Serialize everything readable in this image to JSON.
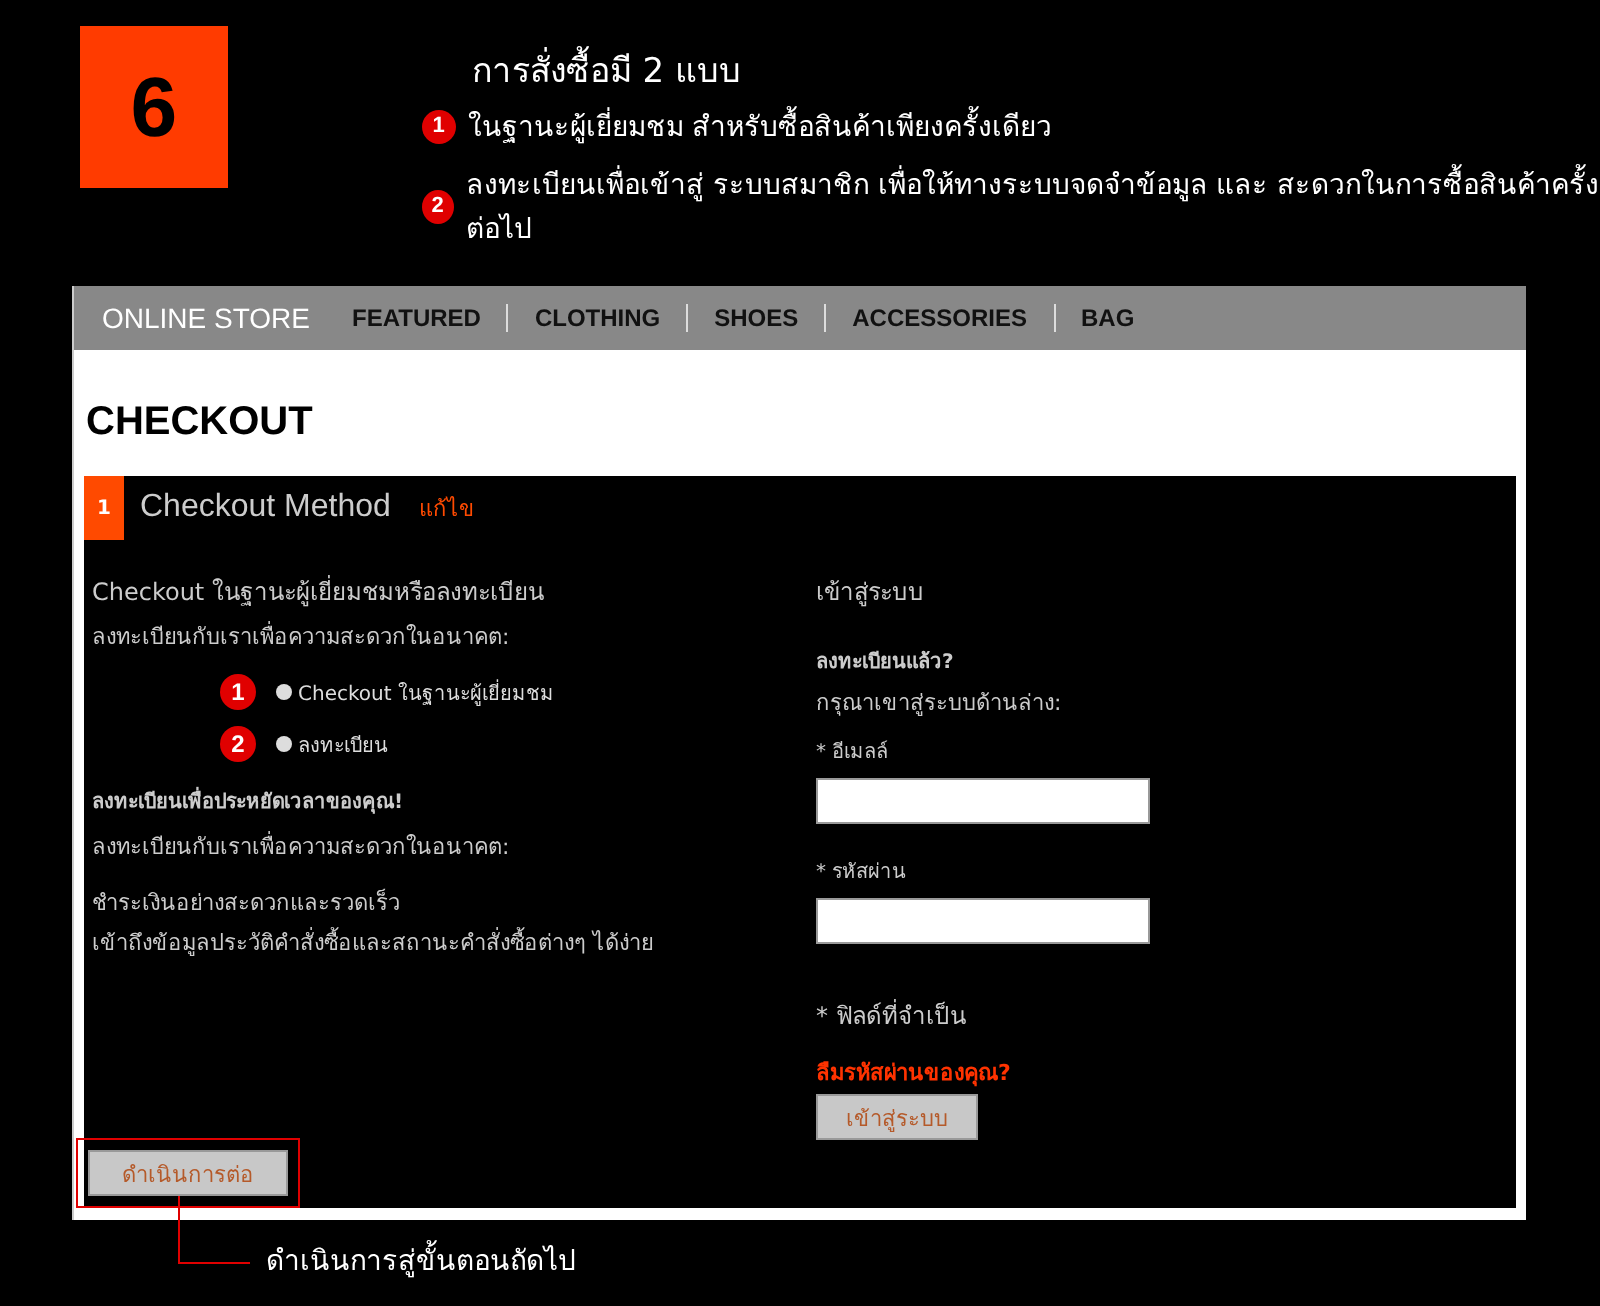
{
  "step": {
    "number": "6",
    "title": "การสั่งซื้อมี 2 แบบ",
    "points": [
      {
        "marker": "1",
        "text": "ในฐานะผู้เยี่ยมชม สำหรับซื้อสินค้าเพียงครั้งเดียว"
      },
      {
        "marker": "2",
        "text": "ลงทะเบียนเพื่อเข้าสู่ ระบบสมาชิก เพื่อให้ทางระบบจดจำข้อมูล และ สะดวกในการซื้อสินค้าครั้งต่อไป"
      }
    ]
  },
  "nav": {
    "brand": "ONLINE STORE",
    "items": [
      "FEATURED",
      "CLOTHING",
      "SHOES",
      "ACCESSORIES",
      "BAG"
    ]
  },
  "page_title": "CHECKOUT",
  "section": {
    "number": "1",
    "title": "Checkout Method",
    "edit_link": "แก้ไข"
  },
  "guest": {
    "heading": "Checkout ในฐานะผู้เยี่ยมชมหรือลงทะเบียน",
    "subheading": "ลงทะเบียนกับเราเพื่อความสะดวกในอนาคต:",
    "options": [
      {
        "marker": "1",
        "label": "Checkout ในฐานะผู้เยี่ยมชม",
        "selected": false
      },
      {
        "marker": "2",
        "label": "ลงทะเบียน",
        "selected": false
      }
    ],
    "benefits_title": "ลงทะเบียนเพื่อประหยัดเวลาของคุณ!",
    "benefits_intro": "ลงทะเบียนกับเราเพื่อความสะดวกในอนาคต:",
    "benefits": [
      "ชำระเงินอย่างสะดวกและรวดเร็ว",
      "เข้าถึงข้อมูลประวัติคำสั่งซื้อและสถานะคำสั่งซื้อต่างๆ ได้ง่าย"
    ],
    "continue_button": "ดำเนินการต่อ"
  },
  "login": {
    "heading": "เข้าสู่ระบบ",
    "registered": "ลงทะเบียนแล้ว?",
    "prompt": "กรุณาเขาสู่ระบบด้านล่าง:",
    "fields": [
      {
        "label": "* อีเมลล์"
      },
      {
        "label": "* รหัสผ่าน"
      }
    ],
    "required_note": "* ฟิลด์ที่จำเป็น",
    "forgot_link": "ลืมรหัสผ่านของคุณ?",
    "login_button": "เข้าสู่ระบบ"
  },
  "callout": "ดำเนินการสู่ขั้นตอนถัดไป"
}
